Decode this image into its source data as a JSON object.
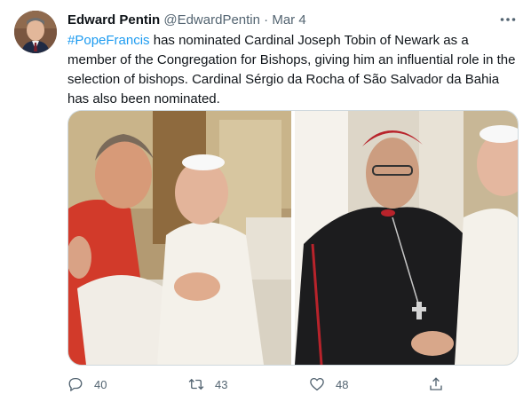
{
  "tweet": {
    "display_name": "Edward Pentin",
    "handle": "@EdwardPentin",
    "separator": "·",
    "date": "Mar 4",
    "hashtag": "#PopeFrancis",
    "body": " has nominated Cardinal Joseph Tobin of Newark as a member of the Congregation for Bishops, giving him an influential role in the selection of bishops. Cardinal Sérgio da Rocha of São Salvador da Bahia has also been nominated."
  },
  "icons": {
    "more": "more-horizontal-icon",
    "reply": "reply-icon",
    "retweet": "retweet-icon",
    "like": "like-icon",
    "share": "share-icon"
  },
  "actions": {
    "reply_count": "40",
    "retweet_count": "43",
    "like_count": "48"
  },
  "colors": {
    "link": "#1d9bf0",
    "secondary": "#536471",
    "text": "#0f1419"
  }
}
